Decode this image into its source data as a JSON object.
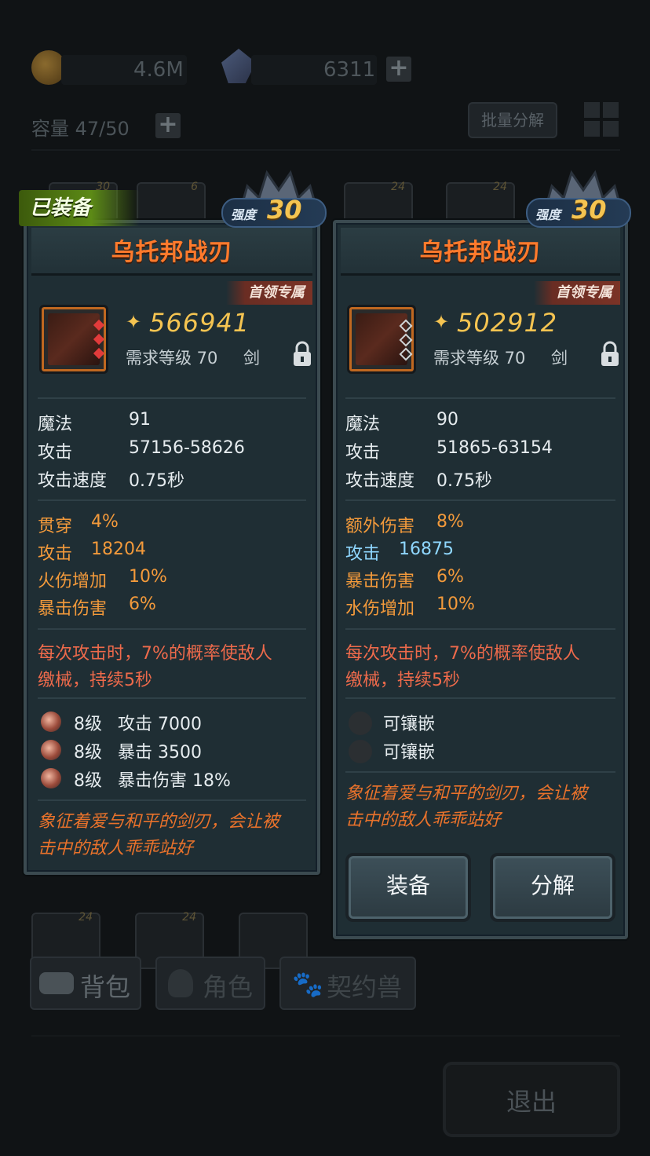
{
  "resources": {
    "gold": "4.6M",
    "crystal": "6311"
  },
  "inventory": {
    "capacity_label": "容量 47/50",
    "batch_decompose_label": "批量分解"
  },
  "nav": {
    "bag": "背包",
    "character": "角色",
    "pet": "契约兽"
  },
  "exit_label": "退出",
  "thumb_levels": [
    "30",
    "6",
    "24",
    "24",
    "24",
    "24"
  ],
  "equipped_badge": "已装备",
  "left_card": {
    "title": "乌托邦战刃",
    "strength_label": "强度",
    "strength_value": "30",
    "exclusive": "首领专属",
    "power": "566941",
    "requirement": "需求等级 70",
    "type": "剑",
    "base_stats": [
      {
        "label": "魔法",
        "value": "91"
      },
      {
        "label": "攻击",
        "value": "57156-58626"
      },
      {
        "label": "攻击速度",
        "value": "0.75秒"
      }
    ],
    "extra_stats": [
      {
        "label": "贯穿",
        "value": "4%",
        "color": "orange"
      },
      {
        "label": "攻击",
        "value": "18204",
        "color": "orange"
      },
      {
        "label": "火伤增加",
        "value": "10%",
        "color": "orange"
      },
      {
        "label": "暴击伤害",
        "value": "6%",
        "color": "orange"
      }
    ],
    "special_line1": "每次攻击时，7%的概率使敌人",
    "special_line2": "缴械，持续5秒",
    "gems": [
      {
        "level": "8级",
        "stat": "攻击 7000"
      },
      {
        "level": "8级",
        "stat": "暴击 3500"
      },
      {
        "level": "8级",
        "stat": "暴击伤害 18%"
      }
    ],
    "flavor_line1": "象征着爱与和平的剑刃，会让被",
    "flavor_line2": "击中的敌人乖乖站好"
  },
  "right_card": {
    "title": "乌托邦战刃",
    "strength_label": "强度",
    "strength_value": "30",
    "exclusive": "首领专属",
    "power": "502912",
    "requirement": "需求等级 70",
    "type": "剑",
    "base_stats": [
      {
        "label": "魔法",
        "value": "90"
      },
      {
        "label": "攻击",
        "value": "51865-63154"
      },
      {
        "label": "攻击速度",
        "value": "0.75秒"
      }
    ],
    "extra_stats": [
      {
        "label": "额外伤害",
        "value": "8%",
        "color": "orange"
      },
      {
        "label": "攻击",
        "value": "16875",
        "color": "cyan"
      },
      {
        "label": "暴击伤害",
        "value": "6%",
        "color": "orange"
      },
      {
        "label": "水伤增加",
        "value": "10%",
        "color": "orange"
      }
    ],
    "special_line1": "每次攻击时，7%的概率使敌人",
    "special_line2": "缴械，持续5秒",
    "sockets": [
      "可镶嵌",
      "可镶嵌"
    ],
    "flavor_line1": "象征着爱与和平的剑刃，会让被",
    "flavor_line2": "击中的敌人乖乖站好",
    "equip_button": "装备",
    "decompose_button": "分解"
  },
  "colors": {
    "title": "#ff7a2c",
    "power": "#f5c451",
    "orange_stat": "#f39a3b",
    "cyan_stat": "#8fd7ff",
    "special": "#ee6a4b",
    "flavor": "#e9722b"
  }
}
